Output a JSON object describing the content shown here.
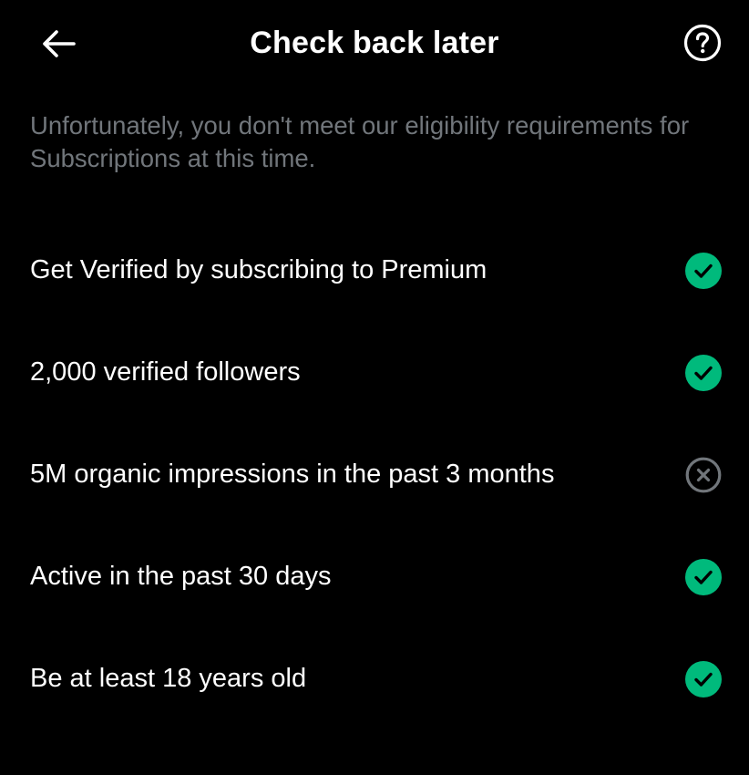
{
  "header": {
    "title": "Check back later",
    "back_icon": "arrow-left-icon",
    "help_icon": "question-circle-icon"
  },
  "subtitle": "Unfortunately, you don't meet our eligibility requirements for Subscriptions at this time.",
  "requirements": [
    {
      "label": "Get Verified by subscribing to Premium",
      "status": "met"
    },
    {
      "label": "2,000 verified followers",
      "status": "met"
    },
    {
      "label": "5M organic impressions in the past 3 months",
      "status": "not-met"
    },
    {
      "label": "Active in the past 30 days",
      "status": "met"
    },
    {
      "label": "Be at least 18 years old",
      "status": "met"
    }
  ],
  "colors": {
    "background": "#000000",
    "met": "#00ba7c",
    "not_met": "#71767b",
    "subtitle": "#71767b",
    "text": "#ffffff"
  }
}
